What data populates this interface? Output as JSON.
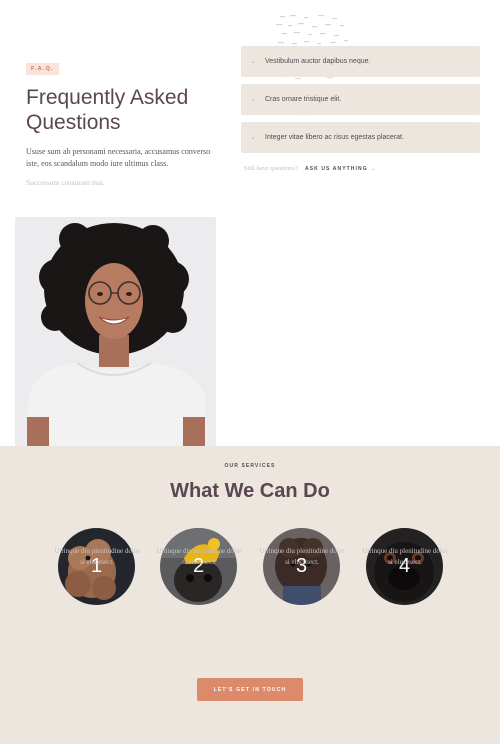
{
  "faq": {
    "badge": "F.A.Q.",
    "title": "Frequently Asked Questions",
    "description": "Ususe sum ab personami necessaria, accusamus converso iste, eos scandalum modo iure ultimus class.",
    "note": "Successum censuram mai.",
    "items": [
      {
        "question": "Vestibulum auctor dapibus neque."
      },
      {
        "question": "Cras ornare tristique elit."
      },
      {
        "question": "Integer vitae libero ac risus egestas placerat."
      }
    ],
    "still_text": "Still have questions?",
    "ask_link": "ASK US ANYTHING →"
  },
  "services": {
    "kicker": "OUR SERVICES",
    "title": "What We Can Do",
    "items": [
      {
        "number": "1",
        "text": "Utrinque diu plenitudine dolor si elucesect."
      },
      {
        "number": "2",
        "text": "Utrinque diu plenitudine dolor si elucesect."
      },
      {
        "number": "3",
        "text": "Utrinque diu plenitudine dolor si elucesect."
      },
      {
        "number": "4",
        "text": "Utrinque diu plenitudine dolor si elucesect."
      }
    ],
    "cta_label": "LET'S GET IN TOUCH"
  },
  "colors": {
    "accent": "#dd8a6a",
    "badge_bg": "#fbe3d9",
    "panel": "#ece6df",
    "heading": "#5c4751"
  }
}
